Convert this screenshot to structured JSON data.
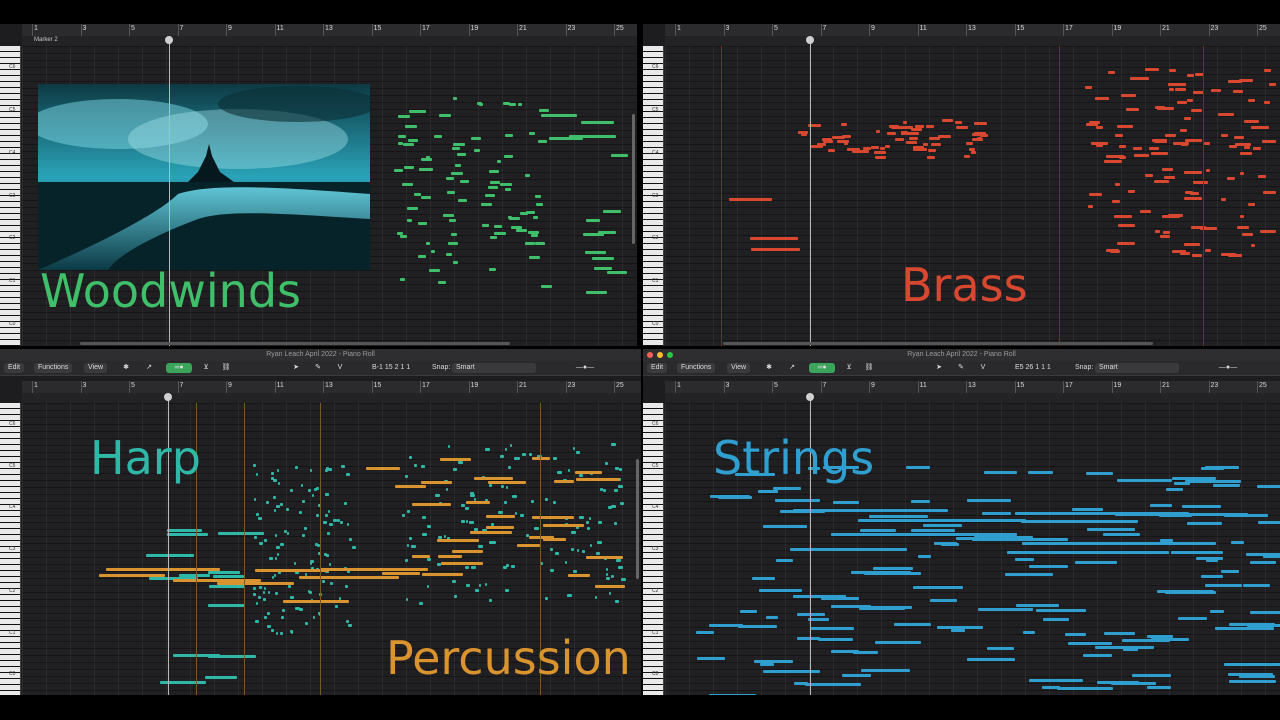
{
  "window_title": "Ryan Leach April 2022 - Piano Roll",
  "marker_label": "Marker 2",
  "labels": {
    "woodwinds": "Woodwinds",
    "brass": "Brass",
    "harp": "Harp",
    "percussion": "Percussion",
    "strings": "Strings"
  },
  "colors": {
    "woodwinds": "#3fbf6a",
    "brass": "#d8472f",
    "harp": "#2fb8a8",
    "percussion": "#d9932f",
    "strings": "#2e9fcf"
  },
  "toolbar_left": {
    "edit": "Edit",
    "functions": "Functions",
    "view": "View",
    "position": "B-1  15 2 1 1",
    "snap_label": "Snap:",
    "snap_value": "Smart"
  },
  "toolbar_right": {
    "edit": "Edit",
    "functions": "Functions",
    "view": "View",
    "position": "E5  26 1 1 1",
    "snap_label": "Snap:",
    "snap_value": "Smart"
  },
  "bar_numbers": [
    "1",
    "3",
    "5",
    "7",
    "9",
    "11",
    "13",
    "15",
    "17",
    "19",
    "21",
    "23",
    "25"
  ],
  "key_labels": [
    "C6",
    "C5",
    "C4",
    "C3",
    "C2",
    "C1",
    "C0"
  ],
  "icons": {
    "traffic_close": "close-icon",
    "traffic_min": "minimize-icon",
    "traffic_zoom": "zoom-icon",
    "pointer": "pointer-tool-icon",
    "pencil": "pencil-tool-icon",
    "midi_in": "midi-in-icon",
    "catch": "catch-icon",
    "link": "link-icon",
    "snap": "snap-icon"
  }
}
